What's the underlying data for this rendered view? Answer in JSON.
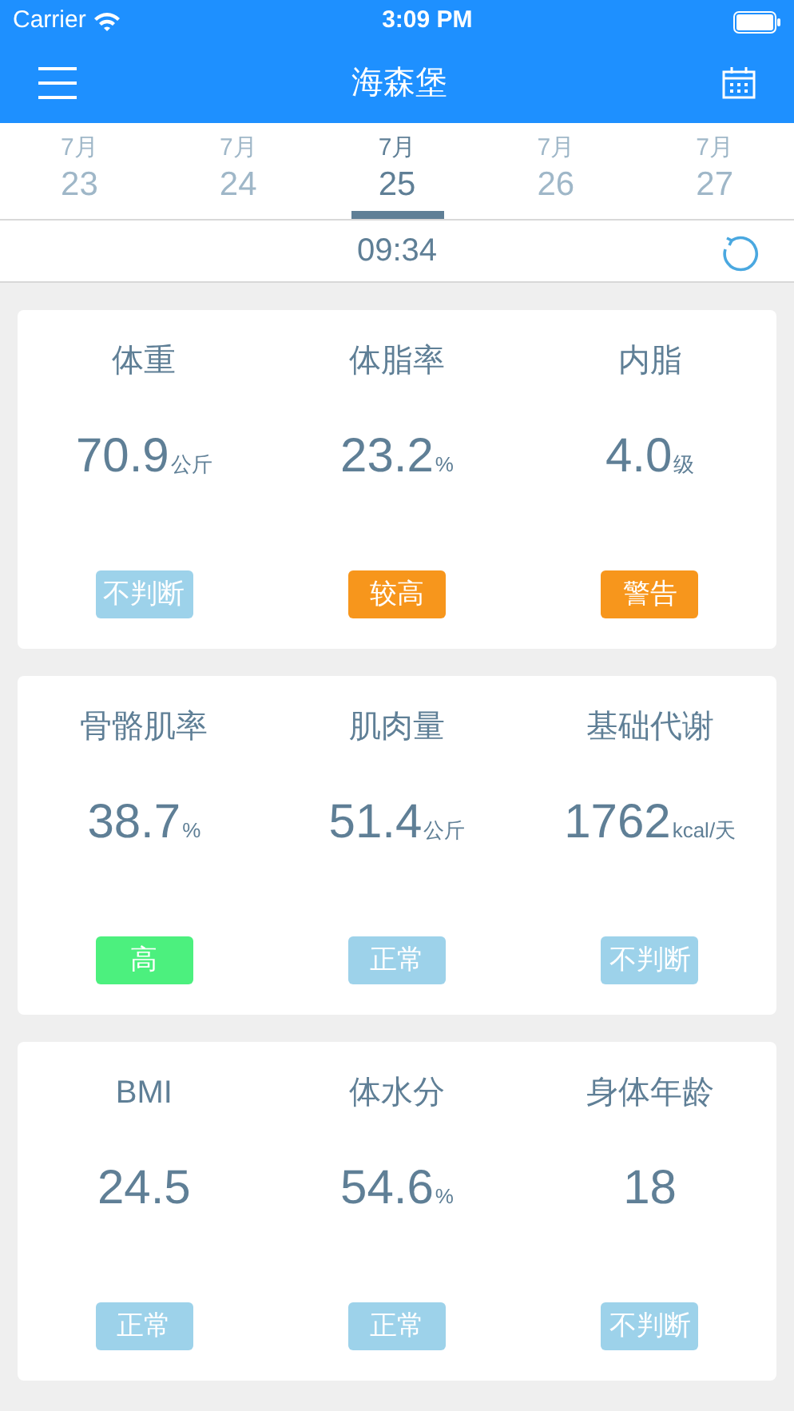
{
  "status_bar": {
    "carrier": "Carrier",
    "time": "3:09 PM"
  },
  "nav_bar": {
    "title": "海森堡"
  },
  "dates": [
    {
      "month": "7月",
      "day": "23",
      "selected": false
    },
    {
      "month": "7月",
      "day": "24",
      "selected": false
    },
    {
      "month": "7月",
      "day": "25",
      "selected": true
    },
    {
      "month": "7月",
      "day": "26",
      "selected": false
    },
    {
      "month": "7月",
      "day": "27",
      "selected": false
    }
  ],
  "measure_time": "09:34",
  "cards": [
    {
      "metrics": [
        {
          "label": "体重",
          "value": "70.9",
          "unit": "公斤",
          "badge": "不判断",
          "color": "#9dd2ea"
        },
        {
          "label": "体脂率",
          "value": "23.2",
          "unit": "%",
          "badge": "较高",
          "color": "#f7961c"
        },
        {
          "label": "内脂",
          "value": "4.0",
          "unit": "级",
          "badge": "警告",
          "color": "#f7961c"
        }
      ]
    },
    {
      "metrics": [
        {
          "label": "骨骼肌率",
          "value": "38.7",
          "unit": "%",
          "badge": "高",
          "color": "#4cf07e"
        },
        {
          "label": "肌肉量",
          "value": "51.4",
          "unit": "公斤",
          "badge": "正常",
          "color": "#9dd2ea"
        },
        {
          "label": "基础代谢",
          "value": "1762",
          "unit": "kcal/天",
          "badge": "不判断",
          "color": "#9dd2ea"
        }
      ]
    },
    {
      "metrics": [
        {
          "label": "BMI",
          "value": "24.5",
          "badge": "正常",
          "color": "#9dd2ea"
        },
        {
          "label": "体水分",
          "value": "54.6",
          "unit": "%",
          "badge": "正常",
          "color": "#9dd2ea"
        },
        {
          "label": "身体年龄",
          "value": "18",
          "badge": "不判断",
          "color": "#9dd2ea"
        }
      ]
    }
  ]
}
